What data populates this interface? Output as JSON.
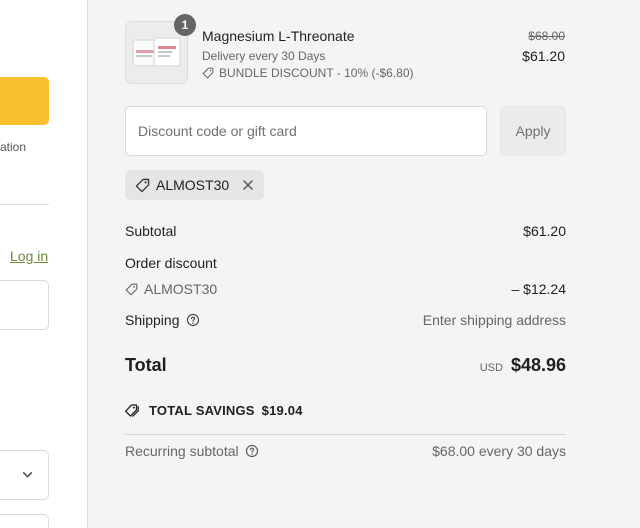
{
  "left": {
    "partial_text": "ation",
    "login_link": "Log in"
  },
  "summary": {
    "product": {
      "name": "Magnesium L-Threonate",
      "quantity": "1",
      "frequency": "Delivery every 30 Days",
      "bundle_discount": "BUNDLE DISCOUNT - 10% (-$6.80)",
      "price_original": "$68.00",
      "price_current": "$61.20"
    },
    "discount": {
      "placeholder": "Discount code or gift card",
      "apply_label": "Apply",
      "applied_code": "ALMOST30"
    },
    "subtotal": {
      "label": "Subtotal",
      "value": "$61.20"
    },
    "order_discount": {
      "label": "Order discount",
      "code": "ALMOST30",
      "value": "– $12.24"
    },
    "shipping": {
      "label": "Shipping",
      "value": "Enter shipping address"
    },
    "total": {
      "label": "Total",
      "currency": "USD",
      "value": "$48.96"
    },
    "savings": {
      "label": "TOTAL SAVINGS",
      "value": "$19.04"
    },
    "recurring": {
      "label": "Recurring subtotal",
      "value": "$68.00 every 30 days"
    }
  },
  "colors": {
    "accent_button": "#fbc02d",
    "link": "#6a8a3a",
    "summary_bg": "#f4f4f4"
  },
  "icons": [
    "tag-icon",
    "close-icon",
    "help-circle-icon",
    "chevron-down-icon"
  ]
}
